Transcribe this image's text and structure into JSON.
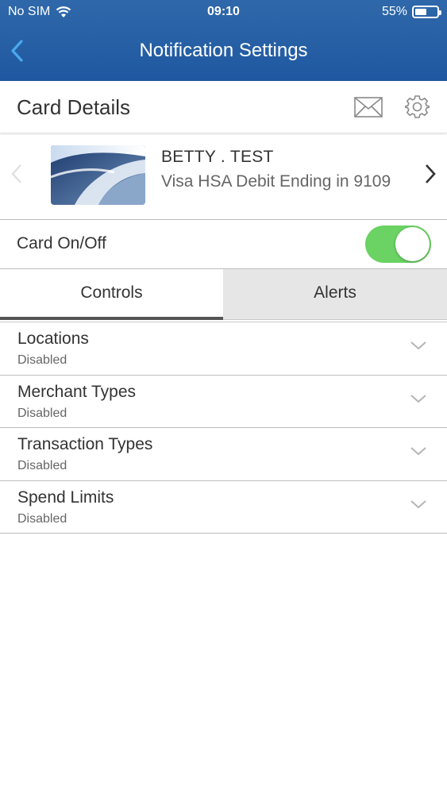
{
  "status_bar": {
    "carrier": "No SIM",
    "time": "09:10",
    "battery": "55%",
    "battery_level": 0.55
  },
  "nav": {
    "title": "Notification Settings"
  },
  "details": {
    "title": "Card Details"
  },
  "card": {
    "holder": "BETTY . TEST",
    "description": "Visa HSA Debit Ending in 9109"
  },
  "card_toggle": {
    "label": "Card On/Off",
    "on": true
  },
  "tabs": [
    {
      "label": "Controls",
      "selected": true
    },
    {
      "label": "Alerts",
      "selected": false
    }
  ],
  "controls": [
    {
      "name": "Locations",
      "state": "Disabled"
    },
    {
      "name": "Merchant Types",
      "state": "Disabled"
    },
    {
      "name": "Transaction Types",
      "state": "Disabled"
    },
    {
      "name": "Spend Limits",
      "state": "Disabled"
    }
  ],
  "colors": {
    "header": "#1f58a0",
    "toggle_on": "#6bd264",
    "back_arrow": "#4aa8ee"
  }
}
